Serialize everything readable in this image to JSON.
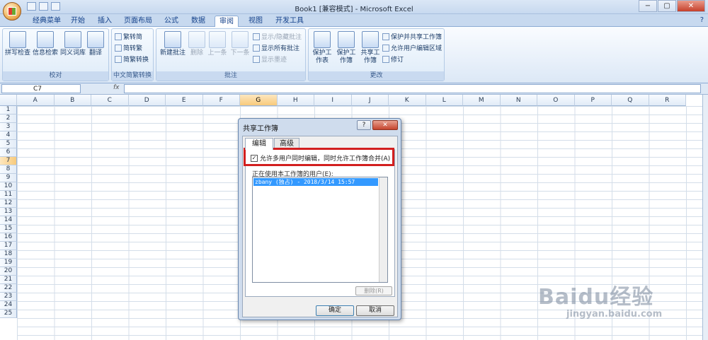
{
  "window": {
    "title": "Book1 [兼容模式] - Microsoft Excel",
    "controls": [
      "−",
      "▢",
      "✕"
    ]
  },
  "qat": {
    "undo": "↶",
    "redo": "↷",
    "dropdown": "▾"
  },
  "tabs": [
    "经典菜单",
    "开始",
    "插入",
    "页面布局",
    "公式",
    "数据",
    "审阅",
    "视图",
    "开发工具"
  ],
  "active_tab": "审阅",
  "help": "?",
  "ribbon": {
    "proofing": {
      "label": "校对",
      "buttons": [
        "拼写检查",
        "信息检索",
        "同义词库",
        "翻译"
      ]
    },
    "chinese": {
      "label": "中文简繁转换",
      "buttons": [
        "繁转简",
        "简转繁",
        "简繁转换"
      ]
    },
    "comments": {
      "label": "批注",
      "big": [
        "新建批注",
        "删除",
        "上一条",
        "下一条"
      ],
      "small": [
        "显示/隐藏批注",
        "显示所有批注",
        "显示墨迹"
      ]
    },
    "changes": {
      "label": "更改",
      "big": [
        "保护工作表",
        "保护工作簿",
        "共享工作簿"
      ],
      "small": [
        "保护并共享工作簿",
        "允许用户编辑区域",
        "修订"
      ]
    }
  },
  "formula": {
    "namebox": "C7",
    "fx": "fx",
    "value": ""
  },
  "columns": [
    "A",
    "B",
    "C",
    "D",
    "E",
    "F",
    "G",
    "H",
    "I",
    "J",
    "K",
    "L",
    "M",
    "N",
    "O",
    "P",
    "Q",
    "R"
  ],
  "selected_column": "G",
  "rows": [
    "1",
    "2",
    "3",
    "4",
    "5",
    "6",
    "7",
    "8",
    "9",
    "10",
    "11",
    "12",
    "13",
    "14",
    "15",
    "16",
    "17",
    "18",
    "19",
    "20",
    "21",
    "22",
    "23",
    "24",
    "25"
  ],
  "selected_row": "7",
  "dialog": {
    "title": "共享工作簿",
    "help": "?",
    "close": "✕",
    "tabs": [
      "编辑",
      "高级"
    ],
    "checkbox_label": "允许多用户同时编辑，同时允许工作簿合并(A)",
    "checkbox_checked": true,
    "users_label": "正在使用本工作簿的用户(E):",
    "users": [
      "zbany (独占) - 2018/3/14 15:57"
    ],
    "remove_button": "删除(R)",
    "ok": "确定",
    "cancel": "取消"
  },
  "watermark": {
    "brand": "Baidu经验",
    "url": "jingyan.baidu.com"
  }
}
